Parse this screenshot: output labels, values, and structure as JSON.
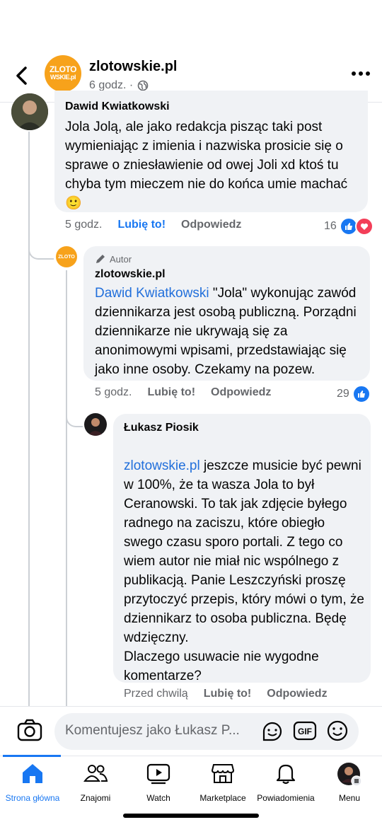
{
  "header": {
    "page_name": "zlotowskie.pl",
    "time": "6 godz. ·",
    "logo_text": [
      "ZLOTO",
      "WSKIE.pl"
    ]
  },
  "comments": [
    {
      "author": "Dawid Kwiatkowski",
      "text": "Jola Jolą, ale jako redakcja pisząc taki post wymieniając z imienia i nazwiska prosicie się o sprawe o zniesławienie od owej Joli xd ktoś tu chyba tym mieczem nie do końca umie machać 🙂",
      "time": "5 godz.",
      "like_label": "Lubię to!",
      "reply_label": "Odpowiedz",
      "reactions": "16"
    },
    {
      "badge": "Autor",
      "author": "zlotowskie.pl",
      "mention": "Dawid Kwiatkowski",
      "text": " \"Jola\" wykonując zawód dziennikarza jest osobą publiczną. Porządni dziennikarze nie ukrywają się za anonimowymi wpisami, przedstawiając się jako inne osoby. Czekamy na pozew.",
      "time": "5 godz.",
      "like_label": "Lubię to!",
      "reply_label": "Odpowiedz",
      "reactions": "29"
    },
    {
      "author": "Łukasz Piosik",
      "mention": "zlotowskie.pl",
      "text": " jeszcze musicie być pewni w 100%, że ta wasza Jola to był Ceranowski. To tak jak zdjęcie byłego radnego na zaciszu, które obiegło swego czasu sporo portali. Z tego co wiem autor nie miał nic wspólnego z publikacją. Panie Leszczyński proszę przytoczyć przepis, który mówi o tym, że dziennikarz to osoba publiczna. Będę wdzięczny.\nDlaczego usuwacie nie wygodne komentarze?",
      "time": "Przed chwilą",
      "like_label": "Lubię to!",
      "reply_label": "Odpowiedz"
    }
  ],
  "composer": {
    "placeholder": "Komentujesz jako Łukasz P..."
  },
  "tabs": [
    {
      "label": "Strona główna",
      "icon": "home-icon",
      "active": true
    },
    {
      "label": "Znajomi",
      "icon": "friends-icon"
    },
    {
      "label": "Watch",
      "icon": "watch-icon"
    },
    {
      "label": "Marketplace",
      "icon": "marketplace-icon"
    },
    {
      "label": "Powiadomienia",
      "icon": "bell-icon"
    },
    {
      "label": "Menu",
      "icon": "profile-avatar-icon"
    }
  ],
  "colors": {
    "accent": "#1877f2",
    "link": "#216fdb",
    "bubble": "#f0f2f5",
    "logo": "#f7a21b",
    "heart": "#f33e58"
  }
}
